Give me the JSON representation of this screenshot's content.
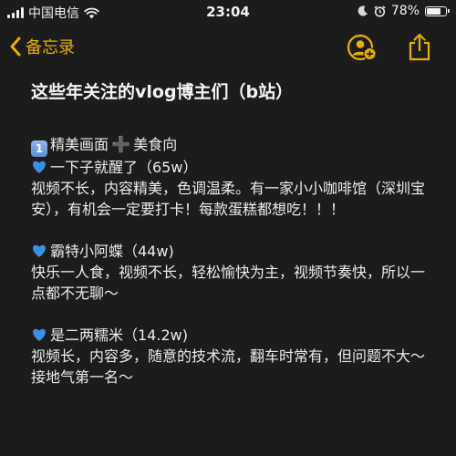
{
  "status_bar": {
    "carrier": "中国电信",
    "time": "23:04",
    "battery_percent": "78%",
    "battery_level": 0.78,
    "icons": [
      "signal-icon",
      "wifi-icon",
      "moon-icon",
      "alarm-icon",
      "battery-icon"
    ]
  },
  "nav": {
    "back_label": "备忘录",
    "accent_color": "#e8b100",
    "icons": [
      "chevron-left-icon",
      "add-person-icon",
      "share-icon"
    ]
  },
  "note": {
    "title": "这些年关注的vlog博主们（b站）",
    "category": {
      "keycap": "1",
      "text1": "精美画面",
      "plus": "➕",
      "text2": "美食向"
    },
    "entries": [
      {
        "icon": "blue-heart-icon",
        "name": "一下子就醒了（65w）",
        "desc": "视频不长，内容精美，色调温柔。有一家小小咖啡馆（深圳宝安），有机会一定要打卡！每款蛋糕都想吃！！！"
      },
      {
        "icon": "blue-heart-icon",
        "name": "霸特小阿蝶（44w)",
        "desc": "快乐一人食，视频不长，轻松愉快为主，视频节奏快，所以一点都不无聊～"
      },
      {
        "icon": "blue-heart-icon",
        "name": "是二两糯米（14.2w)",
        "desc": "视频长，内容多，随意的技术流，翻车时常有，但问题不大～接地气第一名～"
      }
    ]
  }
}
